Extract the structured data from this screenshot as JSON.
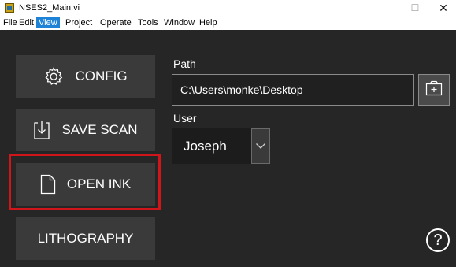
{
  "window": {
    "title": "NSES2_Main.vi",
    "minimize_glyph": "–",
    "maximize_glyph": "☐",
    "close_glyph": "✕"
  },
  "menu": {
    "items": [
      "File",
      "Edit",
      "View",
      "Project",
      "Operate",
      "Tools",
      "Window",
      "Help"
    ],
    "active": "View"
  },
  "sidebar": {
    "config_label": "CONFIG",
    "save_scan_label": "SAVE SCAN",
    "open_ink_label": "OPEN INK",
    "lithography_label": "LITHOGRAPHY"
  },
  "path": {
    "label": "Path",
    "value": "C:\\Users\\monke\\Desktop"
  },
  "user": {
    "label": "User",
    "value": "Joseph"
  },
  "help": {
    "glyph": "?"
  },
  "colors": {
    "panel_bg": "#262626",
    "button_bg": "#3a3a3a",
    "highlight": "#d0161b",
    "menu_active": "#1e82d7"
  },
  "icons": {
    "config": "gear-icon",
    "save_scan": "save-arrow-icon",
    "open_ink": "document-icon",
    "browse": "folder-add-icon",
    "dropdown": "chevron-down-icon",
    "help": "help-icon"
  }
}
